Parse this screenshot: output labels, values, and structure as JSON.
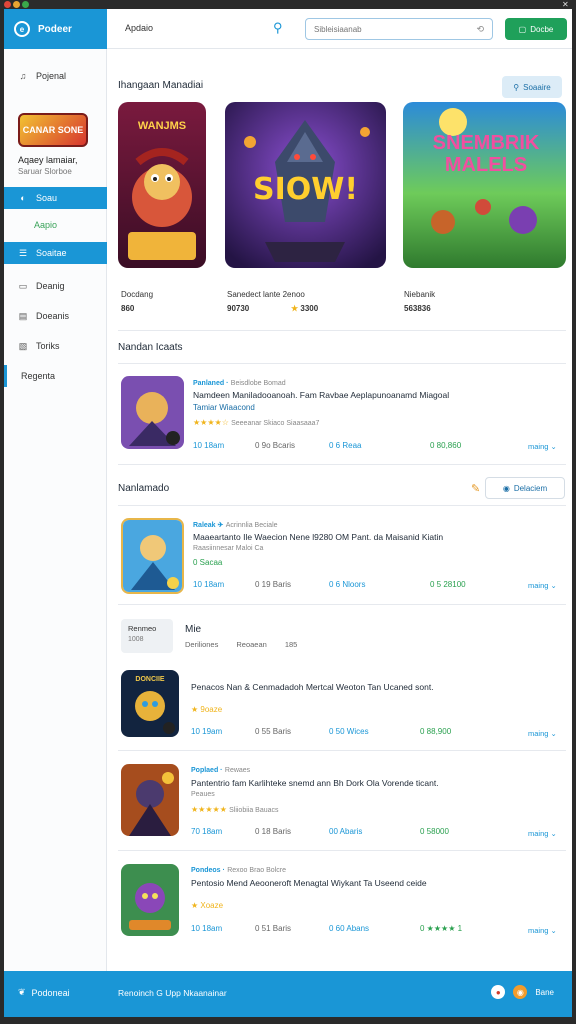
{
  "window": {
    "close_glyph": "✕"
  },
  "brand": {
    "name": "Podeer",
    "logo_glyph": "e"
  },
  "header": {
    "title": "Apdaio",
    "search_placeholder": "Sibleisiaanab",
    "search_clear": "⟲",
    "button_label": "Docbe",
    "button_icon": "▢"
  },
  "sidebar": {
    "top_item": {
      "label": "Pojenal",
      "icon": "♫"
    },
    "promo_text": "CANAR SONE",
    "profile_name": "Aqaey lamaiar,",
    "profile_sub": "Saruar Slorboe",
    "items": [
      {
        "label": "Soau",
        "icon": "◐"
      },
      {
        "label": "Aapio",
        "icon": ""
      },
      {
        "label": "Soaitae",
        "icon": "☰"
      },
      {
        "label": "Deanig",
        "icon": "▭"
      },
      {
        "label": "Doeanis",
        "icon": "▤"
      },
      {
        "label": "Toriks",
        "icon": "▧"
      },
      {
        "label": "Regenta",
        "icon": ""
      }
    ]
  },
  "featured": {
    "title": "Ihangaan Manadiai",
    "button_label": "Soaaire",
    "button_icon": "⚲",
    "cards": [
      {
        "art_text": "WANJMS",
        "badge": "",
        "name": "Docdang",
        "meta": "860",
        "rating": ""
      },
      {
        "art_text": "SIOW!",
        "badge": "",
        "name": "Sanedect lante 2enoo",
        "meta": "90730",
        "rating": "3300"
      },
      {
        "art_text": "SNEMBRIK MALELS",
        "badge": "",
        "name": "Niebanik",
        "meta": "563836",
        "rating": ""
      }
    ]
  },
  "popular": {
    "title": "Nandan Icaats",
    "items": [
      {
        "tag": "Panlaned ·",
        "tag_extra": "Beisdlobe Bomad",
        "title": "Namdeen Maniladooanoah. Fam Ravbae Aeplapunoanamd Miagoal",
        "sub": "Tamiar Wiaacond",
        "stars": "★★★★☆",
        "stars_extra": "Seeeanar Skiaco Siaasaaa7",
        "stat1": "10 18am",
        "stat2": "0 9o Bcaris",
        "stat3": "0 6 Reaa",
        "stat4": "0 80,860",
        "more": "maing"
      }
    ]
  },
  "recommended": {
    "title": "Nanlamado",
    "edit_icon": "✎",
    "button_label": "Delaciem",
    "button_icon": "◉",
    "items": [
      {
        "tag": "Raleak ✈",
        "tag_extra": "Acrinnlia Beciale",
        "title": "Maaeartanto Ile Waecion Nene l9280 OM Pant. da Maisanid Kiatin",
        "sub": "Raasiinnesar Maloi Ca",
        "stars": "0 Sacaa",
        "stars_extra": "",
        "stat1": "10 18am",
        "stat2": "0 19 Baris",
        "stat3": "0 6 Nloors",
        "stat4": "0 5 28100",
        "more": "maing"
      }
    ]
  },
  "misc": {
    "chip_title": "Renmeo",
    "chip_sub": "1008",
    "heading": "Mie",
    "sub1": "Deriliones",
    "sub2": "Reoaean",
    "sub3": "185"
  },
  "more_items": [
    {
      "art": "DONCIIE",
      "tag": "",
      "title": "Penacos Nan & Cenmadadoh Mertcal Weoton Tan Ucaned sont.",
      "sub": "",
      "stars": "★ 9oaze",
      "stars_extra": "",
      "stat1": "10 19am",
      "stat2": "0 55 Baris",
      "stat3": "0 50 Wices",
      "stat4": "0 88,900",
      "more": "maing"
    },
    {
      "art": "",
      "tag": "Poplaed ·",
      "tag_extra": "Rewaes",
      "title": "Pantentrio fam Karlihteke snemd ann Bh Dork Ola Vorende ticant.",
      "sub": "Peaues",
      "stars": "★★★★★",
      "stars_extra": "Sliiobiia Bauacs",
      "stat1": "70 18am",
      "stat2": "0 18 Baris",
      "stat3": "00 Abaris",
      "stat4": "0 58000",
      "more": "maing"
    },
    {
      "art": "",
      "tag": "Pondeos ·",
      "tag_extra": "Rexoo Brao Bolcre",
      "title": "Pentosio Mend Aeooneroft Menagtal Wiykant Ta Useend ceide",
      "sub": "",
      "stars": "★ Xoaze",
      "stars_extra": "",
      "stat1": "10 18am",
      "stat2": "0 51 Baris",
      "stat3": "0 60 Abans",
      "stat4": "0 ★★★★ 1",
      "more": "maing"
    }
  ],
  "footer": {
    "brand": "Podoneai",
    "brand_icon": "❦",
    "text": "Renoinch G Upp Nkaanainar",
    "icon_label": "Bane"
  }
}
